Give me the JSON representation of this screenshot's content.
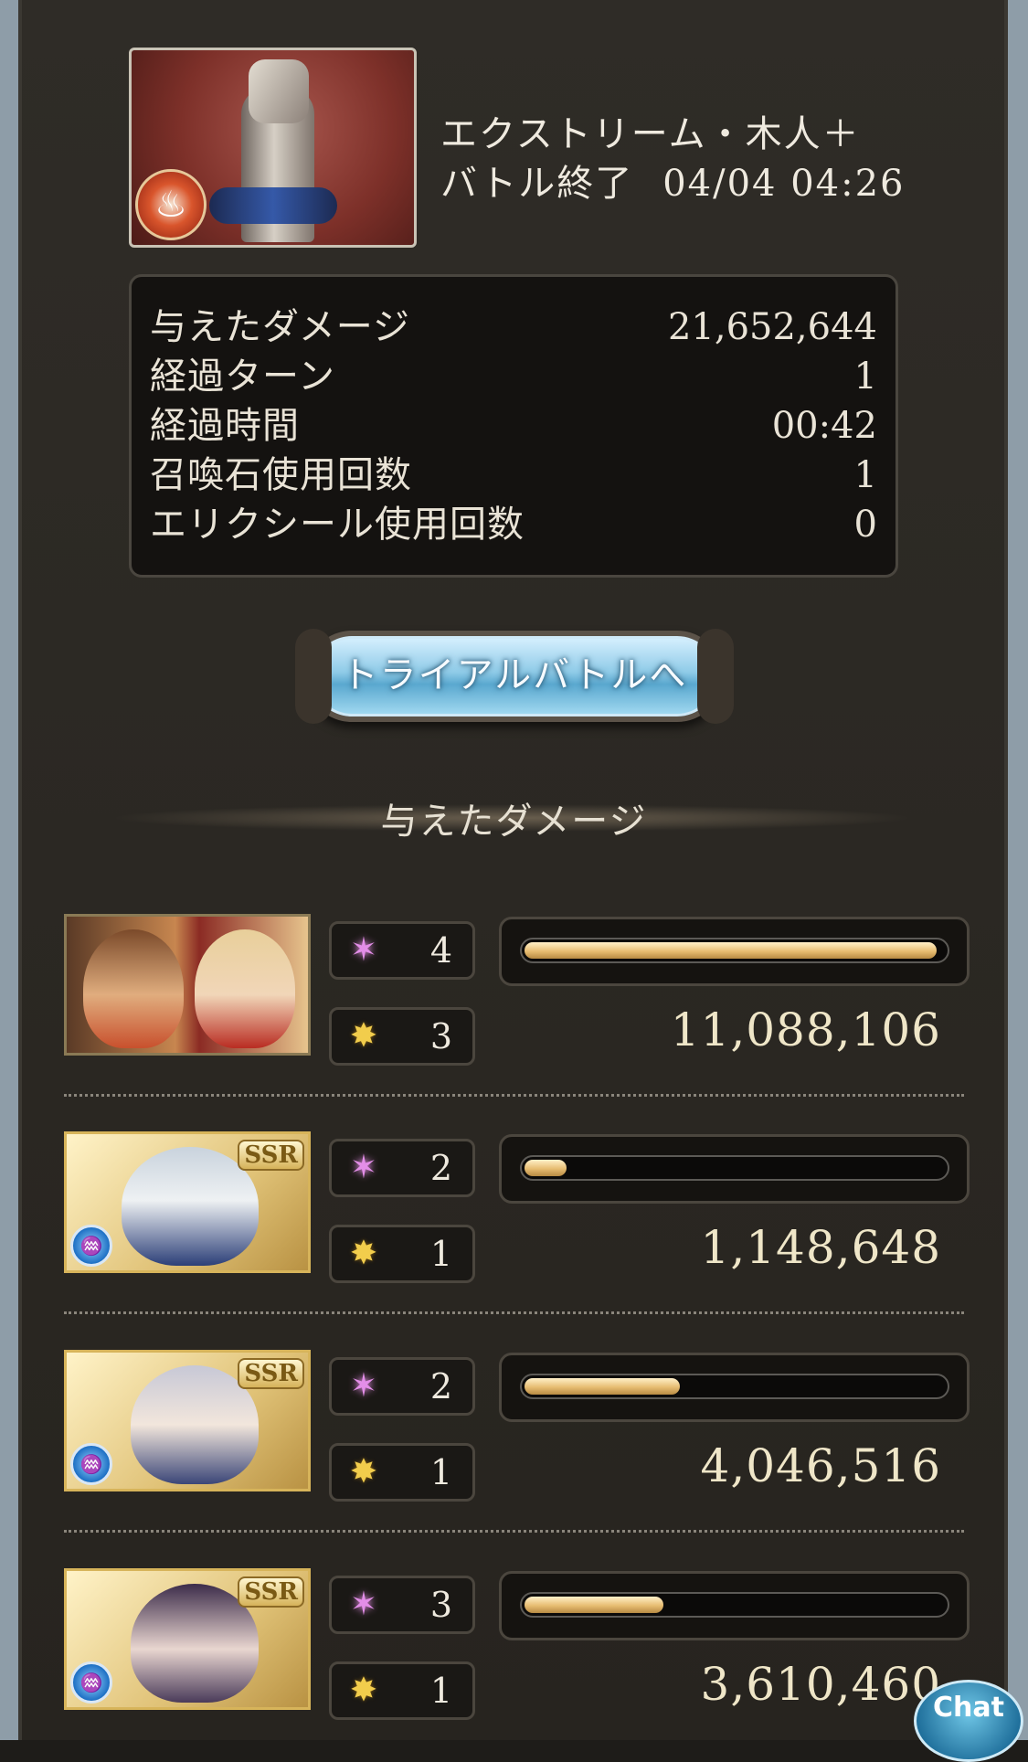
{
  "quest": {
    "name": "エクストリーム・木人＋",
    "status": "バトル終了",
    "datetime": "04/04 04:26"
  },
  "stats": [
    {
      "label": "与えたダメージ",
      "value": "21,652,644"
    },
    {
      "label": "経過ターン",
      "value": "1"
    },
    {
      "label": "経過時間",
      "value": "00:42"
    },
    {
      "label": "召喚石使用回数",
      "value": "1"
    },
    {
      "label": "エリクシール使用回数",
      "value": "0"
    }
  ],
  "trial_button": "トライアルバトルへ",
  "damage_section_title": "与えたダメージ",
  "characters": [
    {
      "ability_count": "4",
      "ougi_count": "3",
      "damage": "11,088,106",
      "damage_fraction": 0.98,
      "ssr": false,
      "element": ""
    },
    {
      "ability_count": "2",
      "ougi_count": "1",
      "damage": "1,148,648",
      "damage_fraction": 0.1,
      "ssr": true,
      "ssr_label": "SSR",
      "element": "water"
    },
    {
      "ability_count": "2",
      "ougi_count": "1",
      "damage": "4,046,516",
      "damage_fraction": 0.37,
      "ssr": true,
      "ssr_label": "SSR",
      "element": "water"
    },
    {
      "ability_count": "3",
      "ougi_count": "1",
      "damage": "3,610,460",
      "damage_fraction": 0.33,
      "ssr": true,
      "ssr_label": "SSR",
      "element": "water"
    }
  ],
  "icons": {
    "ability": "ability-sparkle-icon",
    "ougi": "ougi-burst-icon",
    "element_fire": "fire-element-icon",
    "element_water": "water-element-icon"
  },
  "colors": {
    "bar_fill": "#e7bd72",
    "ssr_gold": "#d7b45a"
  },
  "chat_label": "Chat"
}
